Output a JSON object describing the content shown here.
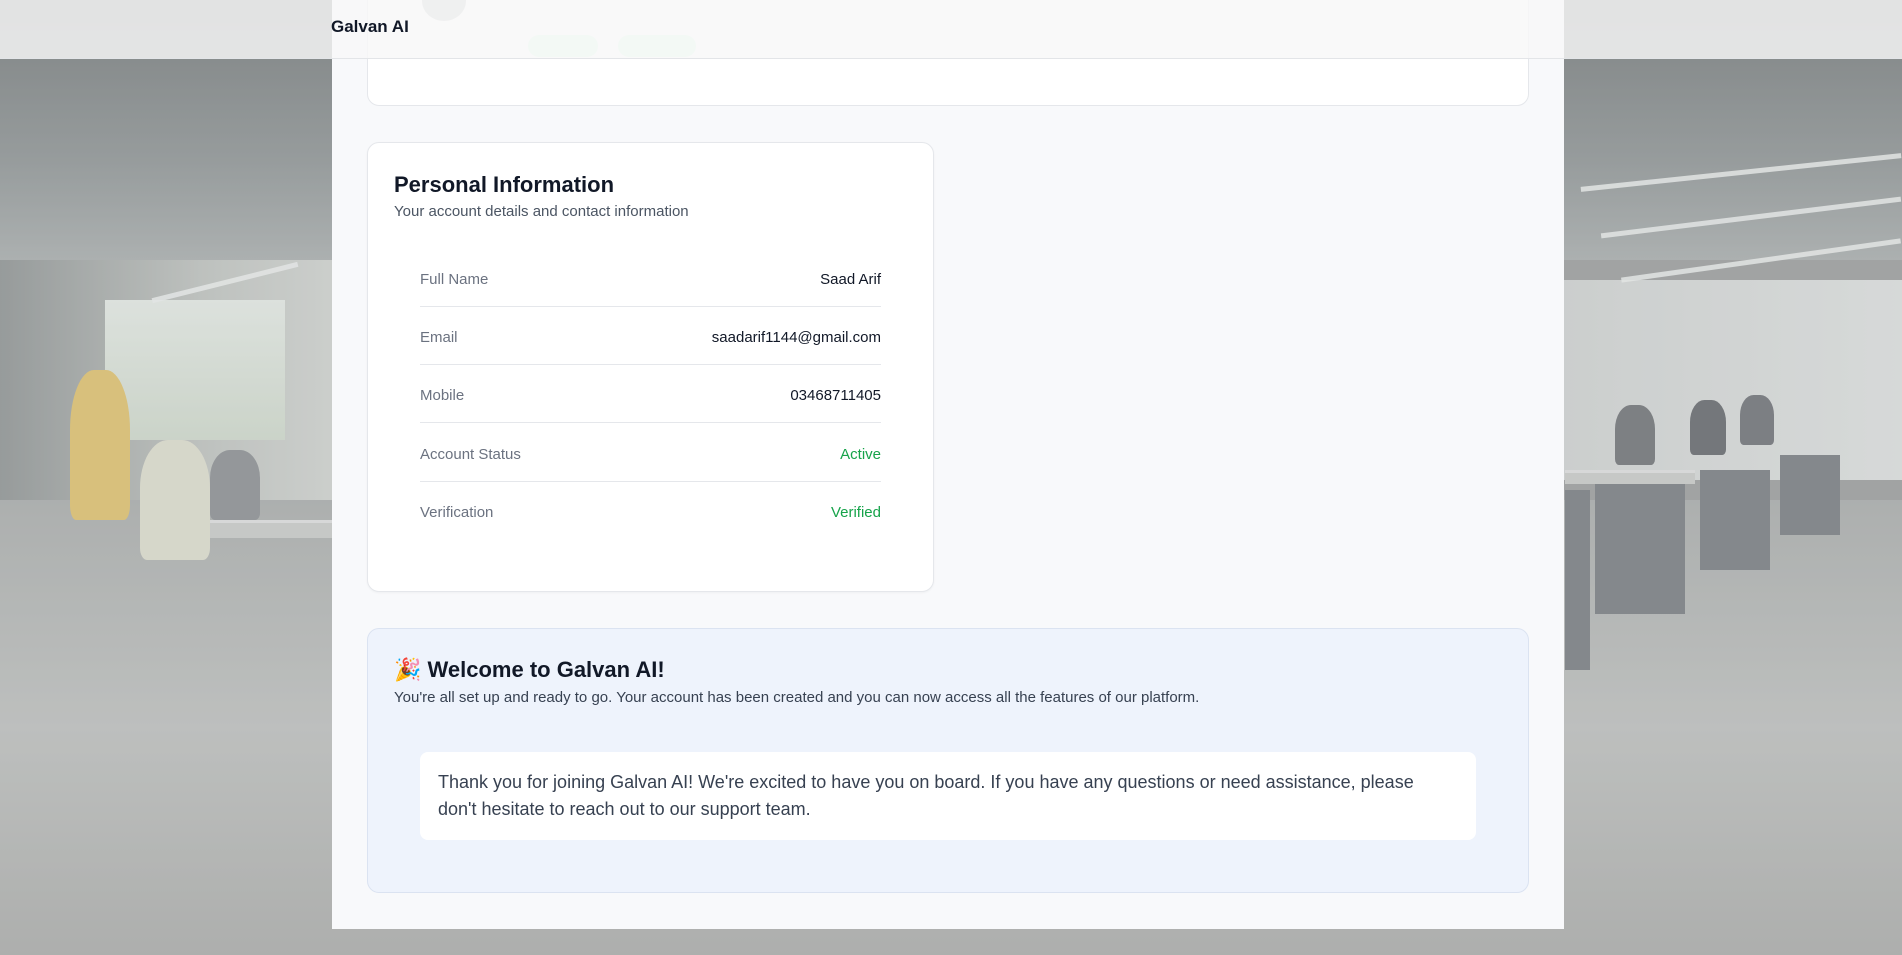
{
  "app": {
    "brand": "Galvan AI"
  },
  "personal_info": {
    "title": "Personal Information",
    "subtitle": "Your account details and contact information",
    "rows": [
      {
        "label": "Full Name",
        "value": "Saad Arif"
      },
      {
        "label": "Email",
        "value": "saadarif1144@gmail.com"
      },
      {
        "label": "Mobile",
        "value": "03468711405"
      },
      {
        "label": "Account Status",
        "value": "Active"
      },
      {
        "label": "Verification",
        "value": "Verified"
      }
    ]
  },
  "welcome": {
    "emoji": "🎉",
    "title": "Welcome to Galvan AI!",
    "subtitle": "You're all set up and ready to go. Your account has been created and you can now access all the features of our platform.",
    "message": "Thank you for joining Galvan AI! We're excited to have you on board. If you have any questions or need assistance, please don't hesitate to reach out to our support team."
  },
  "colors": {
    "status_ok": "#16a34a",
    "welcome_bg": "#eef3fc",
    "text_primary": "#111827"
  }
}
